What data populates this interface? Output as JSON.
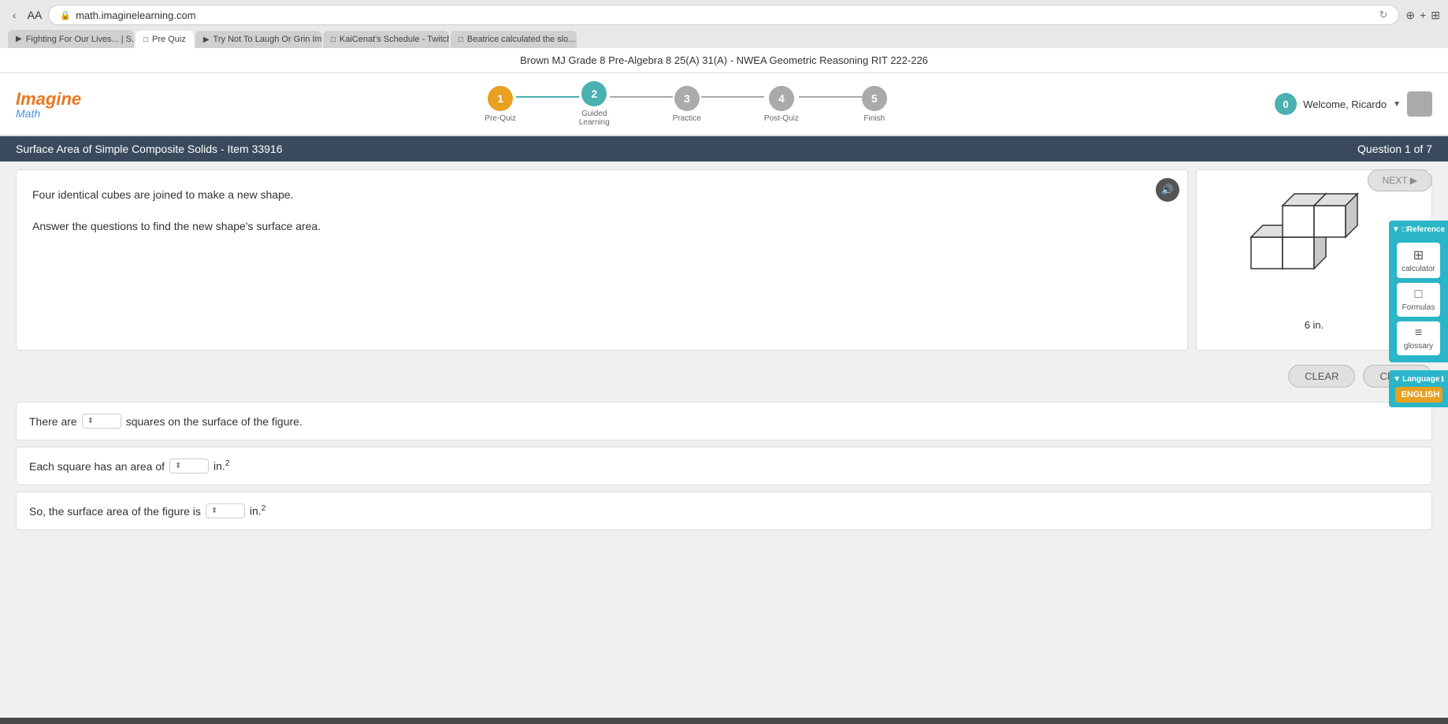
{
  "browser": {
    "address": "math.imaginelearning.com",
    "tabs": [
      {
        "id": "tab1",
        "label": "Fighting For Our Lives... | S...",
        "active": false,
        "icon": "▶"
      },
      {
        "id": "tab2",
        "label": "Pre Quiz",
        "active": true,
        "icon": "□"
      },
      {
        "id": "tab3",
        "label": "Try Not To Laugh Or Grin Im...",
        "active": false,
        "icon": "▶"
      },
      {
        "id": "tab4",
        "label": "KaiCenat's Schedule - Twitch",
        "active": false,
        "icon": "□"
      },
      {
        "id": "tab5",
        "label": "Beatrice calculated the slo...",
        "active": false,
        "icon": "□"
      }
    ]
  },
  "breadcrumb": "Brown MJ Grade 8 Pre-Algebra 8 25(A) 31(A) - NWEA Geometric Reasoning RIT 222-226",
  "header": {
    "logo_imagine": "Imagine",
    "logo_math": "Math",
    "welcome_text": "Welcome, Ricardo",
    "score": "0"
  },
  "progress": {
    "steps": [
      {
        "number": "1",
        "label": "Pre-Quiz",
        "state": "active"
      },
      {
        "number": "2",
        "label": "Guided\nLearning",
        "state": "teal"
      },
      {
        "number": "3",
        "label": "Practice",
        "state": "gray"
      },
      {
        "number": "4",
        "label": "Post-Quiz",
        "state": "gray"
      },
      {
        "number": "5",
        "label": "Finish",
        "state": "gray"
      }
    ]
  },
  "question_header": {
    "title": "Surface Area of Simple Composite Solids - Item 33916",
    "question_count": "Question 1 of 7"
  },
  "question": {
    "text_line1": "Four identical cubes are joined to make a new shape.",
    "text_line2": "Answer the questions to find the new shape's surface area.",
    "figure_label": "6 in."
  },
  "answer_rows": [
    {
      "prefix": "There are",
      "suffix": "squares on the surface of the figure.",
      "unit": ""
    },
    {
      "prefix": "Each square has an area of",
      "suffix": "in.",
      "superscript": "2",
      "unit": "in.²"
    },
    {
      "prefix": "So, the surface area of the figure is",
      "suffix": "in.",
      "superscript": "2",
      "unit": "in.²"
    }
  ],
  "buttons": {
    "clear": "CLEAR",
    "check": "CHECK",
    "next": "NEXT ▶"
  },
  "reference": {
    "header": "▼ □Reference",
    "items": [
      {
        "icon": "⊞",
        "label": "calculator"
      },
      {
        "icon": "□",
        "label": "Formulas"
      },
      {
        "icon": "≡",
        "label": "glossary"
      }
    ]
  },
  "language": {
    "header": "▼ Language",
    "button": "ENGLISH"
  }
}
